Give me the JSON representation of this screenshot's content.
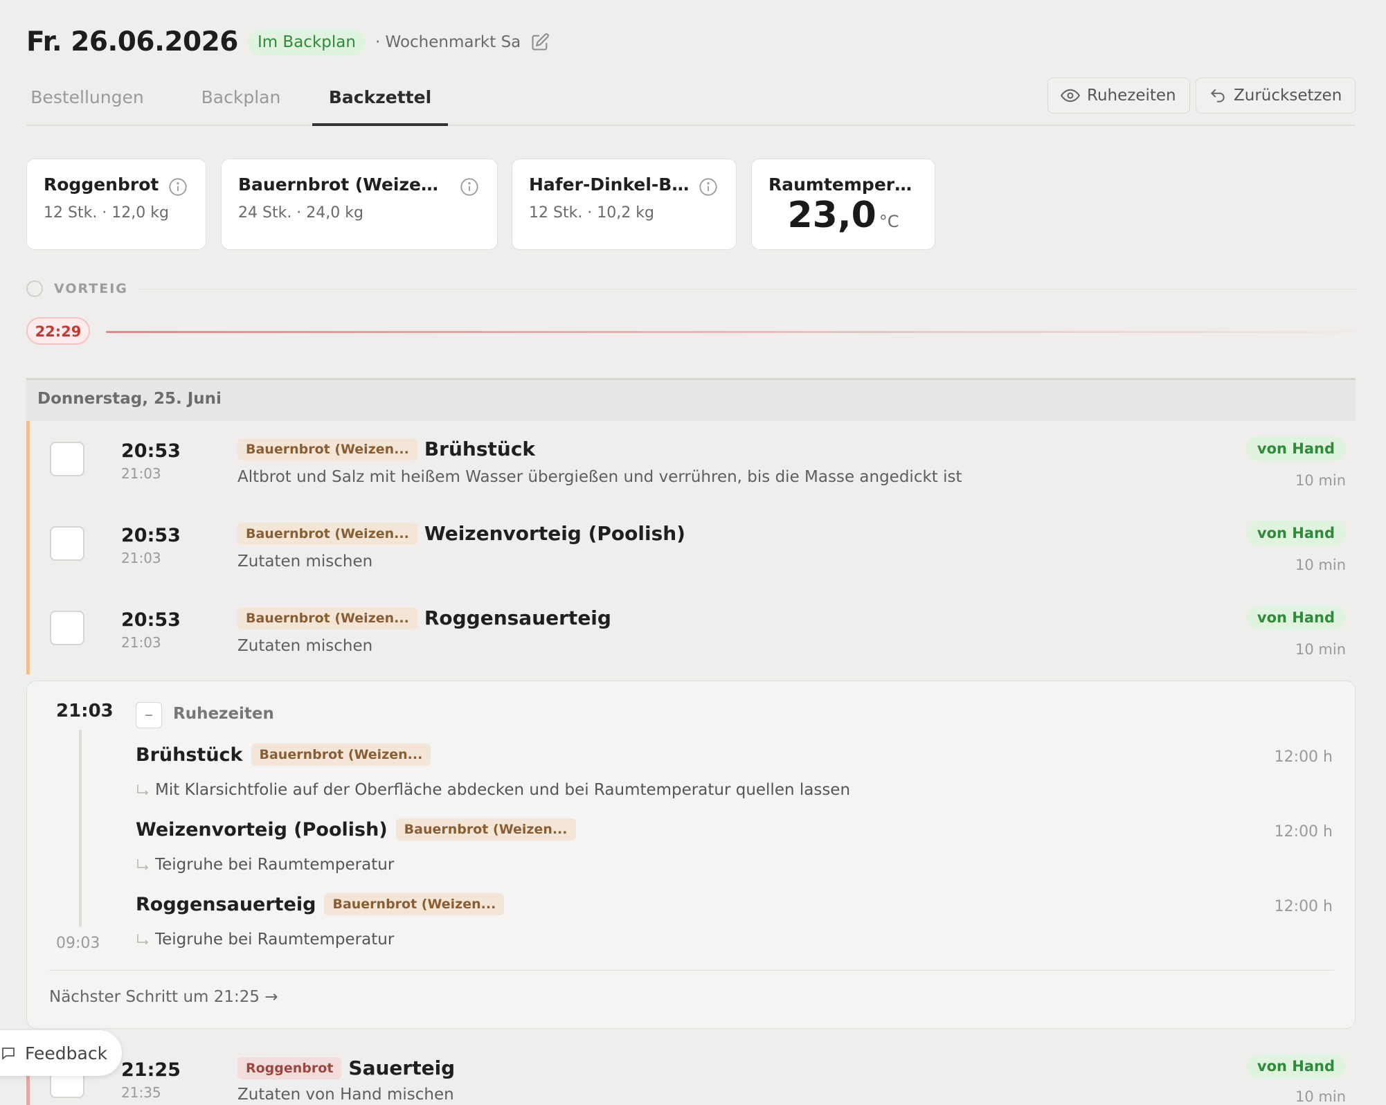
{
  "header": {
    "date": "Fr. 26.06.2026",
    "status": "Im Backplan",
    "subtitle": "· Wochenmarkt Sa"
  },
  "tabs": [
    {
      "label": "Bestellungen",
      "active": false
    },
    {
      "label": "Backplan",
      "active": false
    },
    {
      "label": "Backzettel",
      "active": true
    }
  ],
  "toolbar": {
    "rest_times_label": "Ruhezeiten",
    "reset_label": "Zurücksetzen"
  },
  "products": [
    {
      "name": "Roggenbrot",
      "summary": "12 Stk. · 12,0 kg"
    },
    {
      "name": "Bauernbrot (Weizenmi...",
      "summary": "24 Stk. · 24,0 kg"
    },
    {
      "name": "Hafer-Dinkel-Brot",
      "summary": "12 Stk. · 10,2 kg"
    }
  ],
  "room_temp": {
    "label": "Raumtemperatur",
    "value": "23,0",
    "unit": "°C"
  },
  "section": {
    "label": "VORTEIG"
  },
  "timeline": {
    "badge": "22:29"
  },
  "day": {
    "label": "Donnerstag, 25. Juni"
  },
  "steps": [
    {
      "time": "20:53",
      "end": "21:03",
      "tag": "Bauernbrot (Weizen...",
      "title": "Brühstück",
      "desc": "Altbrot und Salz mit heißem Wasser übergießen und verrühren, bis die Masse angedickt ist",
      "mode": "von Hand",
      "duration": "10 min"
    },
    {
      "time": "20:53",
      "end": "21:03",
      "tag": "Bauernbrot (Weizen...",
      "title": "Weizenvorteig (Poolish)",
      "desc": "Zutaten mischen",
      "mode": "von Hand",
      "duration": "10 min"
    },
    {
      "time": "20:53",
      "end": "21:03",
      "tag": "Bauernbrot (Weizen...",
      "title": "Roggensauerteig",
      "desc": "Zutaten mischen",
      "mode": "von Hand",
      "duration": "10 min"
    },
    {
      "time": "21:25",
      "end": "21:35",
      "tag": "Roggenbrot",
      "title": "Sauerteig",
      "desc": "Zutaten von Hand mischen",
      "mode": "von Hand",
      "duration": "10 min"
    }
  ],
  "rest": {
    "start": "21:03",
    "end": "09:03",
    "label": "Ruhezeiten",
    "collapse_symbol": "–",
    "items": [
      {
        "title": "Brühstück",
        "tag": "Bauernbrot (Weizen...",
        "desc": "Mit Klarsichtfolie auf der Oberfläche abdecken und bei Raumtemperatur quellen lassen",
        "duration": "12:00 h"
      },
      {
        "title": "Weizenvorteig (Poolish)",
        "tag": "Bauernbrot (Weizen...",
        "desc": "Teigruhe bei Raumtemperatur",
        "duration": "12:00 h"
      },
      {
        "title": "Roggensauerteig",
        "tag": "Bauernbrot (Weizen...",
        "desc": "Teigruhe bei Raumtemperatur",
        "duration": "12:00 h"
      }
    ],
    "next": "Nächster Schritt um 21:25 →"
  },
  "feedback": {
    "label": "Feedback"
  },
  "icons": {
    "edit": "edit-icon",
    "eye": "eye-icon",
    "undo": "undo-icon",
    "info": "info-icon",
    "corner": "corner-arrow-icon",
    "chat": "chat-icon"
  },
  "colors": {
    "accent_green": "#2f8a3a",
    "alert_red": "#c23a35",
    "wheat_bar": "#efbf87",
    "rye_bar": "#e5a7a4"
  }
}
